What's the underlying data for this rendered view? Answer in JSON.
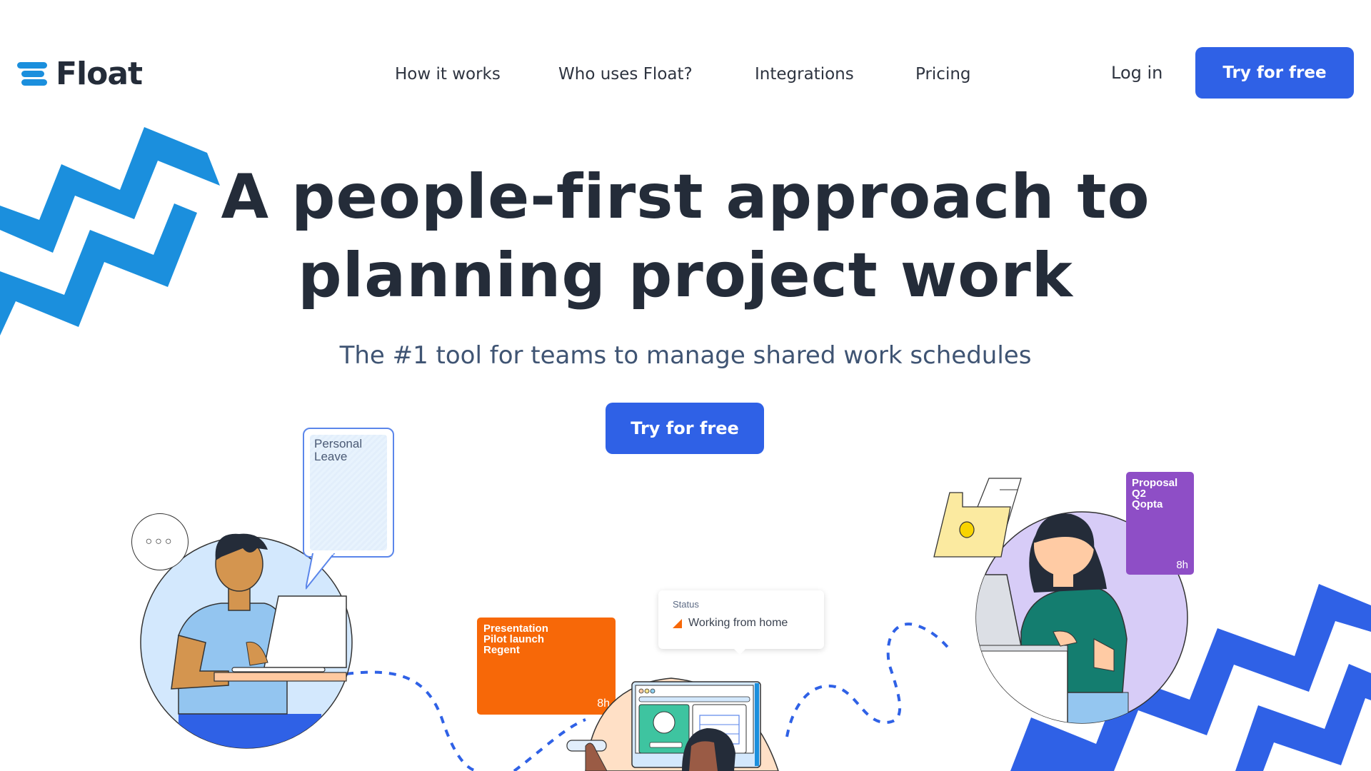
{
  "header": {
    "brand": "Float",
    "nav": [
      {
        "label": "How it works"
      },
      {
        "label": "Who uses Float?"
      },
      {
        "label": "Integrations"
      },
      {
        "label": "Pricing"
      }
    ],
    "login_label": "Log in",
    "cta_label": "Try for free"
  },
  "hero": {
    "headline_line1": "A people-first approach to",
    "headline_line2": "planning project work",
    "subtitle": "The #1 tool for teams to manage shared work schedules",
    "cta_label": "Try for free"
  },
  "illustration": {
    "leave_card": {
      "line1": "Personal",
      "line2": "Leave"
    },
    "chat_bubble": "...",
    "orange_card": {
      "line1": "Presentation",
      "line2": "Pilot launch",
      "line3": "Regent",
      "hours": "8h",
      "color": "#f76808"
    },
    "status_tooltip": {
      "title": "Status",
      "value": "Working from home"
    },
    "purple_card": {
      "line1": "Proposal",
      "line2": "Q2",
      "line3": "Qopta",
      "hours": "8h",
      "color": "#8e4ec6"
    }
  },
  "colors": {
    "accent": "#2f61e6",
    "logo_blue": "#1b8fdd",
    "zigzag_left": "#1b8fdd",
    "zigzag_right": "#2f61e6",
    "text_dark": "#242c39"
  }
}
